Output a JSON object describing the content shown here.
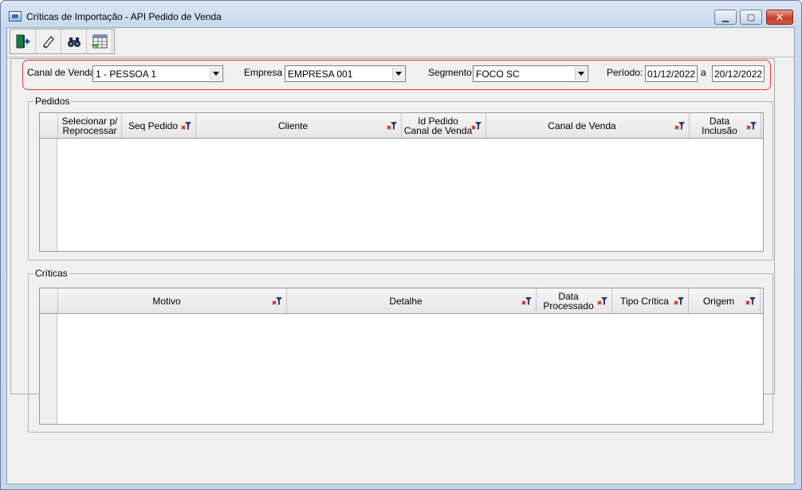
{
  "window": {
    "title": "Críticas de Importação - API Pedido de Venda",
    "controls": {
      "minimize": "▁",
      "maximize": "▢",
      "close": "✕"
    }
  },
  "toolbar": {
    "buttons": [
      {
        "name": "exit",
        "icon": "exit-door-icon"
      },
      {
        "name": "clear",
        "icon": "eraser-icon"
      },
      {
        "name": "search",
        "icon": "binoculars-icon"
      },
      {
        "name": "export",
        "icon": "spreadsheet-export-icon"
      }
    ]
  },
  "filters": {
    "canal_label": "Canal de Venda",
    "canal_value": "1 - PESSOA 1",
    "empresa_label": "Empresa",
    "empresa_value": "EMPRESA 001",
    "segmento_label": "Segmento",
    "segmento_value": "FOCO SC",
    "periodo_label": "Período:",
    "periodo_from": "01/12/2022",
    "periodo_sep": "a",
    "periodo_to": "20/12/2022"
  },
  "pedidos": {
    "title": "Pedidos",
    "columns": [
      {
        "label": "Selecionar p/\nReprocessar",
        "filter": false
      },
      {
        "label": "Seq Pedido",
        "filter": true
      },
      {
        "label": "Cliente",
        "filter": true
      },
      {
        "label": "Id Pedido\nCanal de Venda",
        "filter": true
      },
      {
        "label": "Canal de Venda",
        "filter": true
      },
      {
        "label": "Data\nInclusão",
        "filter": true
      }
    ]
  },
  "criticas": {
    "title": "Críticas",
    "columns": [
      {
        "label": "Motivo",
        "filter": true
      },
      {
        "label": "Detalhe",
        "filter": true
      },
      {
        "label": "Data\nProcessado",
        "filter": true
      },
      {
        "label": "Tipo Crítica",
        "filter": true
      },
      {
        "label": "Origem",
        "filter": true
      }
    ]
  },
  "colors": {
    "highlight_border": "#e53935",
    "window_frame": "#c6d6ec",
    "panel": "#f0f0f0"
  }
}
